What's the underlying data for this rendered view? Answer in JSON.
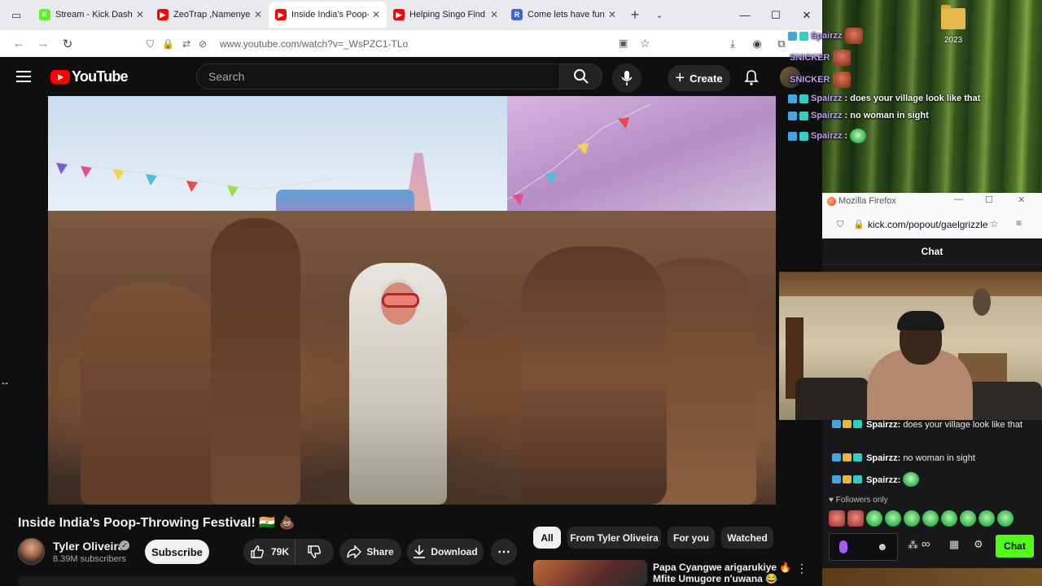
{
  "browser": {
    "tabs": [
      {
        "label": "Stream - Kick Dashboa",
        "fav_color": "#53fc18",
        "fav_letter": "K",
        "active": false
      },
      {
        "label": "ZeoTrap ,Namenye Fa",
        "fav_color": "#ff0000",
        "fav_letter": "▶",
        "active": false
      },
      {
        "label": "Inside India's Poop-Th",
        "fav_color": "#ff0000",
        "fav_letter": "▶",
        "active": true
      },
      {
        "label": "Helping Singo Find a",
        "fav_color": "#ff0000",
        "fav_letter": "▶",
        "active": false
      },
      {
        "label": "Come lets have fun",
        "fav_color": "#3a66d6",
        "fav_letter": "R",
        "active": false
      }
    ],
    "new_tab_symbol": "+",
    "tab_list_symbol": "⌄",
    "url": "www.youtube.com/watch?v=_WsPZC1-TLo"
  },
  "youtube": {
    "logo_text": "YouTube",
    "search_placeholder": "Search",
    "create_label": "Create",
    "video": {
      "title": "Inside India's Poop-Throwing Festival! 🇮🇳 💩",
      "channel": "Tyler Oliveira",
      "subscribers": "8.39M subscribers",
      "subscribe_label": "Subscribe",
      "likes": "79K",
      "share_label": "Share",
      "download_label": "Download"
    },
    "chips": [
      "All",
      "From Tyler Oliveira",
      "For you",
      "Watched"
    ],
    "recommendation": {
      "title_line1": "Papa Cyangwe arigarukiye 🔥",
      "title_line2": "Mfite Umugore n'uwana 😂"
    }
  },
  "overlay": {
    "folder_label": "2023",
    "messages": [
      {
        "user": "Spairzz",
        "text": ""
      },
      {
        "user": "SNICKER",
        "text": ""
      },
      {
        "user": "SNICKER",
        "text": ""
      },
      {
        "user": "Spairzz",
        "text": ": does your village look like that"
      },
      {
        "user": "Spairzz",
        "text": ": no woman in sight"
      },
      {
        "user": "Spairzz",
        "text": ":"
      }
    ]
  },
  "firefox": {
    "title": "Mozilla Firefox",
    "url": "kick.com/popout/gaelgrizzle"
  },
  "kick_chat": {
    "header": "Chat",
    "messages": [
      {
        "user": "Spairzz:",
        "text": "does your village look like that"
      },
      {
        "user": "Spairzz:",
        "text": "no woman in sight"
      },
      {
        "user": "Spairzz:",
        "text": ""
      }
    ],
    "followers_only_label": "Followers only",
    "send_label": "Chat"
  },
  "colors": {
    "kick_green": "#53fc18",
    "youtube_red": "#ff0000",
    "yt_bg": "#0f0f0f"
  }
}
